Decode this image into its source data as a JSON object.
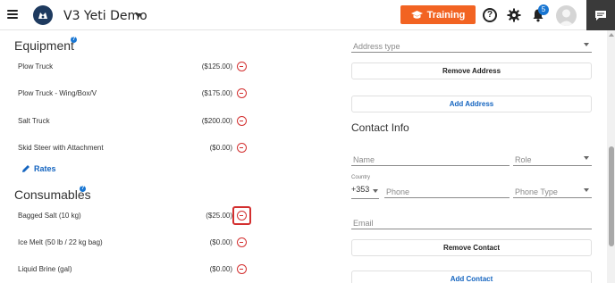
{
  "header": {
    "app_title": "V3 Yeti Demo",
    "training_label": "Training",
    "help_glyph": "?",
    "notification_count": "5",
    "brand_color": "#f26322",
    "badge_color": "#1976d2"
  },
  "equipment": {
    "title": "Equipment",
    "info_glyph": "?",
    "items": [
      {
        "label": "Plow Truck",
        "price": "($125.00)"
      },
      {
        "label": "Plow Truck - Wing/Box/V",
        "price": "($175.00)"
      },
      {
        "label": "Salt Truck",
        "price": "($200.00)"
      },
      {
        "label": "Skid Steer with Attachment",
        "price": "($0.00)"
      }
    ],
    "rates_label": "Rates"
  },
  "consumables": {
    "title": "Consumables",
    "info_glyph": "?",
    "items": [
      {
        "label": "Bagged Salt (10 kg)",
        "price": "($25.00)"
      },
      {
        "label": "Ice Melt (50 lb / 22 kg bag)",
        "price": "($0.00)"
      },
      {
        "label": "Liquid Brine (gal)",
        "price": "($0.00)"
      }
    ]
  },
  "address": {
    "type_placeholder": "Address type",
    "remove_label": "Remove Address",
    "add_label": "Add Address"
  },
  "contact": {
    "title": "Contact Info",
    "name_placeholder": "Name",
    "role_placeholder": "Role",
    "country_label": "Country",
    "country_code": "+353",
    "phone_placeholder": "Phone",
    "phone_type_placeholder": "Phone Type",
    "email_placeholder": "Email",
    "remove_label": "Remove Contact",
    "add_label": "Add Contact"
  },
  "icons": {
    "menu": "hamburger-menu-icon",
    "logo": "yeti-logo-icon",
    "graduation": "graduation-cap-icon",
    "help": "help-icon",
    "settings": "gear-icon",
    "notifications": "bell-icon",
    "chat": "chat-icon",
    "remove": "minus-circle-icon",
    "edit": "pencil-icon"
  }
}
